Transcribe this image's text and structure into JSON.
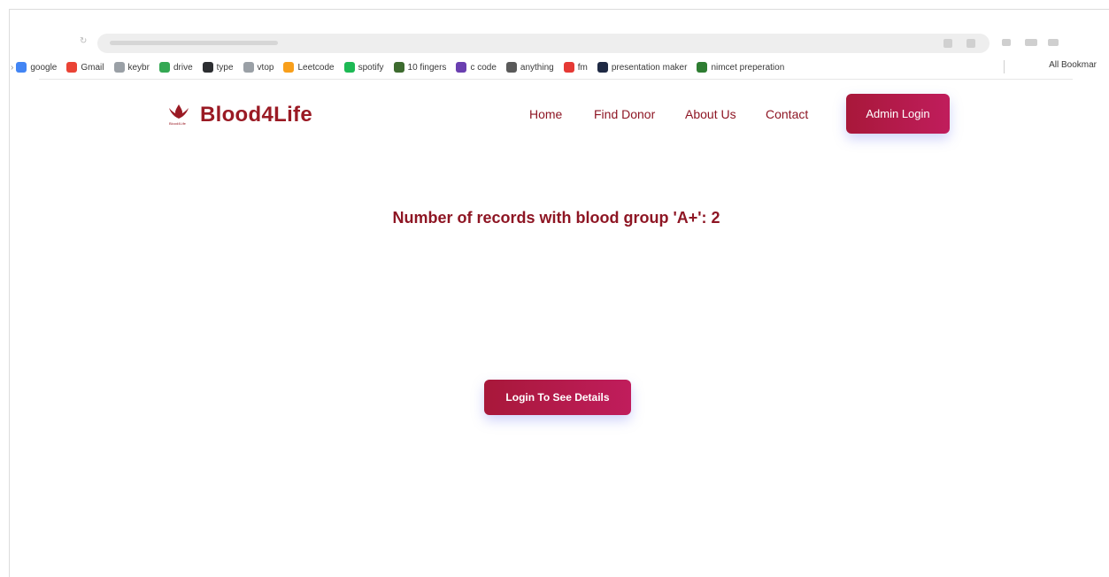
{
  "bookmarks": [
    {
      "label": "google",
      "icon": "google-icon",
      "color": "#4285f4"
    },
    {
      "label": "Gmail",
      "icon": "gmail-icon",
      "color": "#ea4335"
    },
    {
      "label": "keybr",
      "icon": "keybr-icon",
      "color": "#9aa0a6"
    },
    {
      "label": "drive",
      "icon": "drive-icon",
      "color": "#34a853"
    },
    {
      "label": "type",
      "icon": "monkeytype-icon",
      "color": "#2c2e31"
    },
    {
      "label": "vtop",
      "icon": "vtop-icon",
      "color": "#9aa0a6"
    },
    {
      "label": "Leetcode",
      "icon": "leetcode-icon",
      "color": "#f89f1b"
    },
    {
      "label": "spotify",
      "icon": "spotify-icon",
      "color": "#1db954"
    },
    {
      "label": "10 fingers",
      "icon": "tenfingers-icon",
      "color": "#3d6b2f"
    },
    {
      "label": "c code",
      "icon": "ccode-icon",
      "color": "#6a3fb0"
    },
    {
      "label": "anything",
      "icon": "anything-icon",
      "color": "#5a5a5a"
    },
    {
      "label": "fm",
      "icon": "fm-icon",
      "color": "#e53935"
    },
    {
      "label": "presentation maker",
      "icon": "presentation-icon",
      "color": "#1f2a44"
    },
    {
      "label": "nimcet preperation",
      "icon": "tree-icon",
      "color": "#2e7d32"
    }
  ],
  "all_bookmarks_label": "All Bookmar",
  "site": {
    "logo_text": "Blood4Life",
    "logo_caption": "Blood4Life",
    "brand_color": "#9a1a24",
    "nav": [
      "Home",
      "Find Donor",
      "About Us",
      "Contact"
    ],
    "admin_button": "Admin Login"
  },
  "main": {
    "records_text": "Number of records with blood group 'A+': 2",
    "details_button": "Login To See Details"
  }
}
